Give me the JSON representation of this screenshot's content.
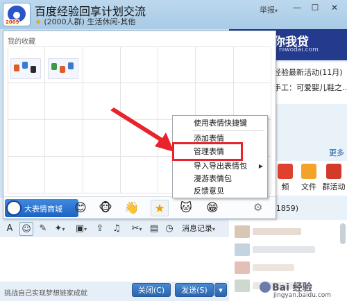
{
  "window": {
    "title": "百度经验回享计划交流",
    "member_info": "(2000人群)",
    "category": "生活休闲-其他",
    "report": "举报",
    "logo_tag": "2009"
  },
  "right_panel": {
    "ad_text": "你我贷",
    "ad_url": "niwodai.com",
    "notices": [
      "经验最新活动(11月)",
      "手工：可爱婴儿鞋之..."
    ],
    "more": "更多",
    "apps": [
      {
        "label": "频",
        "color": "#e0412f"
      },
      {
        "label": "文件",
        "color": "#f2a32a"
      },
      {
        "label": "群活动",
        "color": "#d23b2a"
      }
    ],
    "member_count": "/1859)"
  },
  "emoji_panel": {
    "favorites_title": "我的收藏",
    "shop_label": "大表情商城",
    "packs": [
      {
        "icon": "smile-face-icon",
        "glyph": "😊"
      },
      {
        "icon": "monkey-face-icon",
        "glyph": "🐵"
      },
      {
        "icon": "hand-emoji-icon",
        "glyph": "👋"
      },
      {
        "icon": "star-icon",
        "glyph": "★"
      },
      {
        "icon": "cat-face-icon",
        "glyph": "🐱"
      },
      {
        "icon": "grin-face-icon",
        "glyph": "😁"
      }
    ]
  },
  "context_menu": {
    "items": [
      {
        "label": "使用表情快捷键",
        "submenu": false
      },
      {
        "label": "添加表情",
        "submenu": false
      },
      {
        "label": "管理表情",
        "submenu": false
      },
      {
        "label": "导入导出表情包",
        "submenu": true
      },
      {
        "label": "漫游表情包",
        "submenu": false
      },
      {
        "label": "反馈意见",
        "submenu": false
      }
    ],
    "highlighted": "管理表情"
  },
  "chat": {
    "toolbar": {
      "msg_record": "消息记录"
    },
    "motto": "挑战自己实现梦想链家成就",
    "close_button": "关闭(C)",
    "send_button": "发送(S)"
  },
  "watermark": {
    "title": "Bai 经验",
    "url": "jingyan.baidu.com"
  },
  "colors": {
    "accent": "#2b64b0",
    "highlight": "#e8232b",
    "ad_bg": "#243a8c"
  }
}
